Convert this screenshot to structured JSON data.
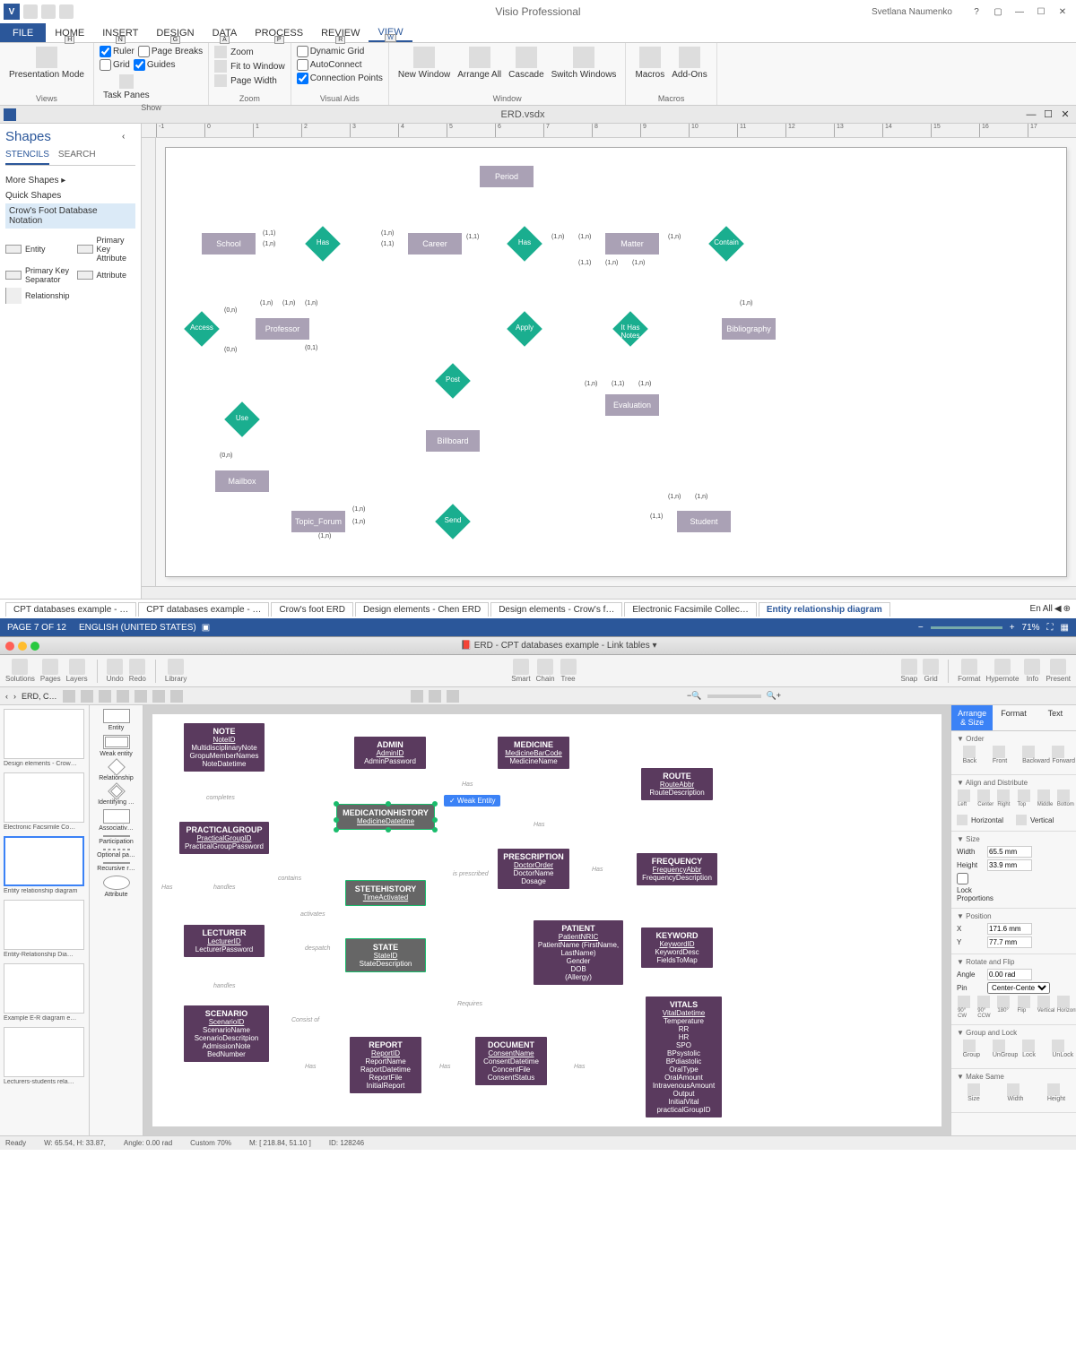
{
  "visio": {
    "app_title": "Visio Professional",
    "user": "Svetlana Naumenko",
    "tabs": {
      "file": "FILE",
      "home": "HOME",
      "insert": "INSERT",
      "design": "DESIGN",
      "data": "DATA",
      "process": "PROCESS",
      "review": "REVIEW",
      "view": "VIEW"
    },
    "keytips": {
      "home": "H",
      "insert": "N",
      "design": "G",
      "data": "A",
      "process": "P",
      "review": "R",
      "view": "W"
    },
    "ribbon": {
      "views": {
        "presentation": "Presentation Mode",
        "lbl": "Views"
      },
      "show": {
        "ruler": "Ruler",
        "grid": "Grid",
        "pagebreaks": "Page Breaks",
        "guides": "Guides",
        "taskpanes": "Task Panes",
        "lbl": "Show"
      },
      "zoom": {
        "zoom": "Zoom",
        "fit": "Fit to Window",
        "pagewidth": "Page Width",
        "lbl": "Zoom"
      },
      "visualaids": {
        "dyn": "Dynamic Grid",
        "auto": "AutoConnect",
        "conn": "Connection Points",
        "lbl": "Visual Aids"
      },
      "window": {
        "new": "New Window",
        "arrange": "Arrange All",
        "cascade": "Cascade",
        "switch": "Switch Windows",
        "lbl": "Window"
      },
      "macros": {
        "macros": "Macros",
        "addons": "Add-Ons",
        "lbl": "Macros"
      }
    },
    "doc_name": "ERD.vsdx",
    "shapes": {
      "title": "Shapes",
      "tab_stencils": "STENCILS",
      "tab_search": "SEARCH",
      "more": "More Shapes",
      "quick": "Quick Shapes",
      "stencil": "Crow's Foot Database Notation",
      "items": {
        "entity": "Entity",
        "pka": "Primary Key Attribute",
        "pks": "Primary Key Separator",
        "attr": "Attribute",
        "rel": "Relationship"
      }
    },
    "diagram": {
      "entities": {
        "period": "Period",
        "school": "School",
        "career": "Career",
        "matter": "Matter",
        "professor": "Professor",
        "bibliography": "Bibliography",
        "evaluation": "Evaluation",
        "billboard": "Billboard",
        "mailbox": "Mailbox",
        "topic_forum": "Topic_Forum",
        "student": "Student"
      },
      "relationships": {
        "has1": "Has",
        "has2": "Has",
        "contain": "Contain",
        "access": "Access",
        "apply": "Apply",
        "ithas": "It Has Notes",
        "post": "Post",
        "use": "Use",
        "send": "Send"
      },
      "cards": {
        "oneone": "(1,1)",
        "onen": "(1,n)",
        "zeron": "(0,n)",
        "zerone": "(0,1)"
      }
    },
    "page_tabs": [
      "CPT databases example - …",
      "CPT databases example - …",
      "Crow's foot ERD",
      "Design elements - Chen ERD",
      "Design elements - Crow's f…",
      "Electronic Facsimile Collec…",
      "Entity relationship diagram"
    ],
    "tab_lang": "En",
    "tab_all": "All",
    "status": {
      "page": "PAGE 7 OF 12",
      "lang": "ENGLISH (UNITED STATES)",
      "zoom": "71%"
    }
  },
  "cd": {
    "title": "ERD - CPT databases example - Link tables",
    "toolbar": {
      "solutions": "Solutions",
      "pages": "Pages",
      "layers": "Layers",
      "undo": "Undo",
      "redo": "Redo",
      "library": "Library",
      "smart": "Smart",
      "chain": "Chain",
      "tree": "Tree",
      "snap": "Snap",
      "grid": "Grid",
      "format": "Format",
      "hypernote": "Hypernote",
      "info": "Info",
      "present": "Present"
    },
    "breadcrumb": "ERD, C…",
    "thumbs": [
      "Design elements - Crow…",
      "Electronic Facsimile Co…",
      "Entity relationship diagram",
      "Entity-Relationship Dia…",
      "Example E-R diagram e…",
      "Lecturers-students rela…"
    ],
    "lib": [
      "Entity",
      "Weak entity",
      "Relationship",
      "Identifying …",
      "Associativ…",
      "Participation",
      "Optional pa…",
      "Recursive r…",
      "Attribute"
    ],
    "weak_tooltip": "✓ Weak Entity",
    "entities": {
      "note": {
        "h": "NOTE",
        "pk": "NoteID",
        "a": [
          "MultidisciplinaryNote",
          "GropuMemberNames",
          "NoteDatetime"
        ]
      },
      "admin": {
        "h": "ADMIN",
        "pk": "AdminID",
        "a": [
          "AdminPassword"
        ]
      },
      "medicine": {
        "h": "MEDICINE",
        "pk": "MedicineBarCode",
        "a": [
          "MedicineName"
        ]
      },
      "route": {
        "h": "ROUTE",
        "pk": "RouteAbbr",
        "a": [
          "RouteDescription"
        ]
      },
      "practicalgroup": {
        "h": "PRACTICALGROUP",
        "pk": "PracticalGroupID",
        "a": [
          "PracticalGroupPassword"
        ]
      },
      "medhist": {
        "h": "MEDICATIONHISTORY",
        "pk": "MedicineDatetime",
        "a": []
      },
      "prescription": {
        "h": "PRESCRIPTION",
        "pk": "DoctorOrder",
        "a": [
          "DoctorName",
          "Dosage"
        ]
      },
      "frequency": {
        "h": "FREQUENCY",
        "pk": "FrequencyAbbr",
        "a": [
          "FrequencyDescription"
        ]
      },
      "statehist": {
        "h": "STETEHISTORY",
        "pk": "TimeActivated",
        "a": []
      },
      "lecturer": {
        "h": "LECTURER",
        "pk": "LecturerID",
        "a": [
          "LecturerPassword"
        ]
      },
      "state": {
        "h": "STATE",
        "pk": "StateID",
        "a": [
          "StateDescription"
        ]
      },
      "patient": {
        "h": "PATIENT",
        "pk": "PatientNRIC",
        "a": [
          "PatientName (FirstName, LastName)",
          "Gender",
          "DOB",
          "(Allergy)"
        ]
      },
      "keyword": {
        "h": "KEYWORD",
        "pk": "KeywordID",
        "a": [
          "KeywordDesc",
          "FieldsToMap"
        ]
      },
      "scenario": {
        "h": "SCENARIO",
        "pk": "ScenarioID",
        "a": [
          "ScenarioName",
          "ScenarioDescritpion",
          "AdmissionNote",
          "BedNumber"
        ]
      },
      "report": {
        "h": "REPORT",
        "pk": "ReportID",
        "a": [
          "ReportName",
          "RaportDatetime",
          "ReportFile",
          "InitialReport"
        ]
      },
      "document": {
        "h": "DOCUMENT",
        "pk": "ConsentName",
        "a": [
          "ConsentDatetime",
          "ConcentFile",
          "ConsentStatus"
        ]
      },
      "vitals": {
        "h": "VITALS",
        "pk": "VitalDatetime",
        "a": [
          "Temperature",
          "RR",
          "HR",
          "SPO",
          "BPsystolic",
          "BPdiastolic",
          "OralType",
          "OralAmount",
          "IntravenousAmount",
          "Output",
          "InitialVital",
          "practicalGroupID"
        ]
      }
    },
    "rel_labels": {
      "completes": "completes",
      "has": "Has",
      "handles": "handles",
      "contains": "contains",
      "activates": "activates",
      "despatch": "despatch",
      "isprescribed": "is prescribed",
      "requires": "Requires",
      "consistof": "Consist of"
    },
    "right": {
      "tabs": {
        "arrange": "Arrange & Size",
        "format": "Format",
        "text": "Text"
      },
      "order": "Order",
      "order_btns": [
        "Back",
        "Front",
        "Backward",
        "Forward"
      ],
      "align": "Align and Distribute",
      "align_btns": [
        "Left",
        "Center",
        "Right",
        "Top",
        "Middle",
        "Bottom"
      ],
      "horiz": "Horizontal",
      "vert": "Vertical",
      "size": "Size",
      "width_l": "Width",
      "width_v": "65.5 mm",
      "height_l": "Height",
      "height_v": "33.9 mm",
      "lockp": "Lock Proportions",
      "position": "Position",
      "x": "X",
      "x_v": "171.6 mm",
      "y": "Y",
      "y_v": "77.7 mm",
      "rotate": "Rotate and Flip",
      "angle_l": "Angle",
      "angle_v": "0.00 rad",
      "pin_l": "Pin",
      "pin_v": "Center-Center",
      "rot_btns": [
        "90° CW",
        "90° CCW",
        "180°",
        "Flip",
        "Vertical",
        "Horizontal"
      ],
      "grouplock": "Group and Lock",
      "gl_btns": [
        "Group",
        "UnGroup",
        "Lock",
        "UnLock"
      ],
      "makesame": "Make Same",
      "ms_btns": [
        "Size",
        "Width",
        "Height"
      ]
    },
    "status": {
      "ready": "Ready",
      "wh": "W: 65.54,  H: 33.87,",
      "angle": "Angle: 0.00 rad",
      "custom": "Custom 70%",
      "m": "M: [ 218.84, 51.10 ]",
      "id": "ID: 128246"
    }
  }
}
